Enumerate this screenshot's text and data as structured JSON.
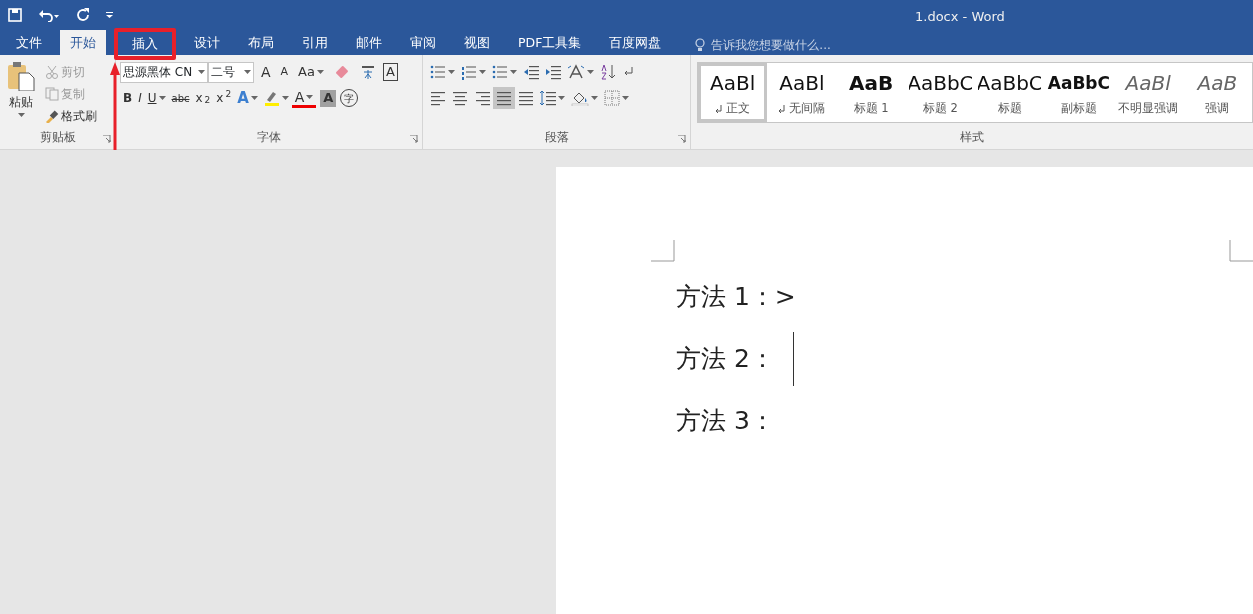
{
  "window": {
    "title": "1.docx - Word"
  },
  "tabs": [
    {
      "label": "文件",
      "selected": false,
      "highlighted": false
    },
    {
      "label": "开始",
      "selected": true,
      "highlighted": false
    },
    {
      "label": "插入",
      "selected": false,
      "highlighted": true
    },
    {
      "label": "设计",
      "selected": false,
      "highlighted": false
    },
    {
      "label": "布局",
      "selected": false,
      "highlighted": false
    },
    {
      "label": "引用",
      "selected": false,
      "highlighted": false
    },
    {
      "label": "邮件",
      "selected": false,
      "highlighted": false
    },
    {
      "label": "审阅",
      "selected": false,
      "highlighted": false
    },
    {
      "label": "视图",
      "selected": false,
      "highlighted": false
    },
    {
      "label": "PDF工具集",
      "selected": false,
      "highlighted": false
    },
    {
      "label": "百度网盘",
      "selected": false,
      "highlighted": false
    }
  ],
  "tell_me": {
    "placeholder": "告诉我您想要做什么..."
  },
  "clipboard": {
    "label": "剪贴板",
    "paste": "粘贴",
    "cut": {
      "label": "剪切",
      "disabled": true
    },
    "copy": {
      "label": "复制",
      "disabled": true
    },
    "format_painter": {
      "label": "格式刷",
      "disabled": false
    }
  },
  "font": {
    "label": "字体",
    "font_name": "思源黑体 CN",
    "font_size": "二号",
    "grow": "A",
    "shrink": "A",
    "change_case": "Aa",
    "char_border": "A",
    "format_buttons": [
      "B",
      "I",
      "U",
      "abc",
      "x$_{2}$",
      "x$^{2}$"
    ],
    "text_effect": "A",
    "font_color": "A",
    "char_shading": "A",
    "enclose": "字"
  },
  "paragraph": {
    "label": "段落",
    "alignments": [
      {
        "selected": false
      },
      {
        "selected": false
      },
      {
        "selected": false
      },
      {
        "selected": true
      },
      {
        "selected": false
      }
    ]
  },
  "styles": {
    "label": "样式",
    "items": [
      {
        "sample": "AaBl",
        "name": "正文",
        "kind": "normal",
        "mark": true,
        "selected": true
      },
      {
        "sample": "AaBl",
        "name": "无间隔",
        "kind": "normal",
        "mark": true,
        "selected": false
      },
      {
        "sample": "AaB",
        "name": "标题 1",
        "kind": "bold",
        "mark": false,
        "selected": false
      },
      {
        "sample": "AaBbC",
        "name": "标题 2",
        "kind": "normal",
        "mark": false,
        "selected": false
      },
      {
        "sample": "AaBbC",
        "name": "标题",
        "kind": "normal",
        "mark": false,
        "selected": false
      },
      {
        "sample": "AaBbC",
        "name": "副标题",
        "kind": "bold",
        "mark": false,
        "selected": false
      },
      {
        "sample": "AaBl",
        "name": "不明显强调",
        "kind": "italic",
        "mark": false,
        "selected": false
      },
      {
        "sample": "AaB",
        "name": "强调",
        "kind": "italic",
        "mark": false,
        "selected": false
      }
    ]
  },
  "document": {
    "lines": [
      {
        "text": "方法 1：>",
        "caret": false
      },
      {
        "text": "方法 2：",
        "caret": true
      },
      {
        "text": "方法 3：",
        "caret": false
      }
    ]
  },
  "annotation": {
    "arrow": true
  }
}
